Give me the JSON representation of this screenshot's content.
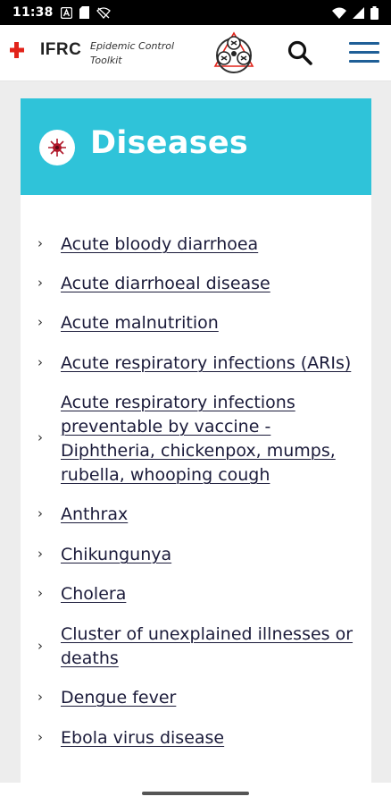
{
  "status_bar": {
    "time": "11:38",
    "left_icons": [
      "a-notification-icon",
      "sd-card-icon",
      "no-signal-icon"
    ],
    "right_icons": [
      "wifi-icon",
      "cellular-icon",
      "battery-icon"
    ]
  },
  "header": {
    "brand": "IFRC",
    "tagline_line1": "Epidemic Control",
    "tagline_line2": "Toolkit",
    "icons": [
      "red-cross-crescent-icon",
      "toolkit-logo",
      "search-icon",
      "hamburger-menu-icon"
    ],
    "colors": {
      "brand_red": "#e2231a",
      "menu_blue": "#1f5f97"
    }
  },
  "card": {
    "title": "Diseases",
    "icon": "virus-icon",
    "colors": {
      "header_bg": "#2fc3d9",
      "title_text": "#ffffff"
    }
  },
  "diseases": [
    {
      "lines": [
        "Acute bloody diarrhoea"
      ]
    },
    {
      "lines": [
        "Acute diarrhoeal disease"
      ]
    },
    {
      "lines": [
        "Acute malnutrition"
      ]
    },
    {
      "lines": [
        "Acute respiratory infections (ARIs)"
      ]
    },
    {
      "lines": [
        "Acute respiratory infections",
        "preventable by vaccine -",
        "Diphtheria, chickenpox, mumps,",
        "rubella, whooping cough"
      ]
    },
    {
      "lines": [
        "Anthrax"
      ]
    },
    {
      "lines": [
        "Chikungunya"
      ]
    },
    {
      "lines": [
        "Cholera"
      ]
    },
    {
      "lines": [
        "Cluster of unexplained illnesses or",
        "deaths"
      ]
    },
    {
      "lines": [
        "Dengue fever"
      ]
    },
    {
      "lines": [
        "Ebola virus disease"
      ]
    }
  ]
}
